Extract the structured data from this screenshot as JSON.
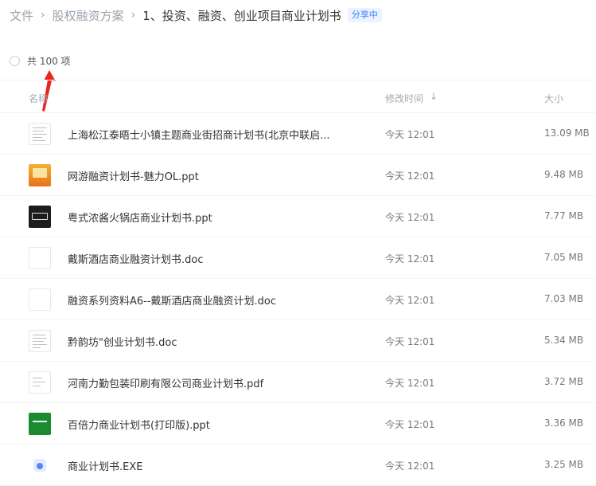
{
  "breadcrumb": {
    "root": "文件",
    "parent": "股权融资方案",
    "separator": "›",
    "current": "1、投资、融资、创业项目商业计划书",
    "badge": "分享中"
  },
  "list": {
    "total_label": "共 100 项",
    "columns": {
      "name": "名称",
      "modified": "修改时间",
      "size": "大小"
    },
    "sort_icon": "↓"
  },
  "files": [
    {
      "name": "上海松江泰晤士小镇主题商业街招商计划书(北京中联启...",
      "time": "今天 12:01",
      "size": "13.09 MB",
      "icon": "doc-thumb-icon"
    },
    {
      "name": "网游融资计划书-魅力OL.ppt",
      "time": "今天 12:01",
      "size": "9.48 MB",
      "icon": "ppt-orange-thumb-icon"
    },
    {
      "name": "粤式浓酱火锅店商业计划书.ppt",
      "time": "今天 12:01",
      "size": "7.77 MB",
      "icon": "ppt-black-thumb-icon"
    },
    {
      "name": "戴斯酒店商业融资计划书.doc",
      "time": "今天 12:01",
      "size": "7.05 MB",
      "icon": "blank-doc-icon"
    },
    {
      "name": "融资系列资料A6--戴斯酒店商业融资计划.doc",
      "time": "今天 12:01",
      "size": "7.03 MB",
      "icon": "blank-doc-icon"
    },
    {
      "name": "黔韵坊\"创业计划书.doc",
      "time": "今天 12:01",
      "size": "5.34 MB",
      "icon": "doc-thumb-icon"
    },
    {
      "name": "河南力勤包装印刷有限公司商业计划书.pdf",
      "time": "今天 12:01",
      "size": "3.72 MB",
      "icon": "pdf-thumb-icon"
    },
    {
      "name": "百倍力商业计划书(打印版).ppt",
      "time": "今天 12:01",
      "size": "3.36 MB",
      "icon": "ppt-green-thumb-icon"
    },
    {
      "name": "商业计划书.EXE",
      "time": "今天 12:01",
      "size": "3.25 MB",
      "icon": "exe-file-icon"
    }
  ]
}
